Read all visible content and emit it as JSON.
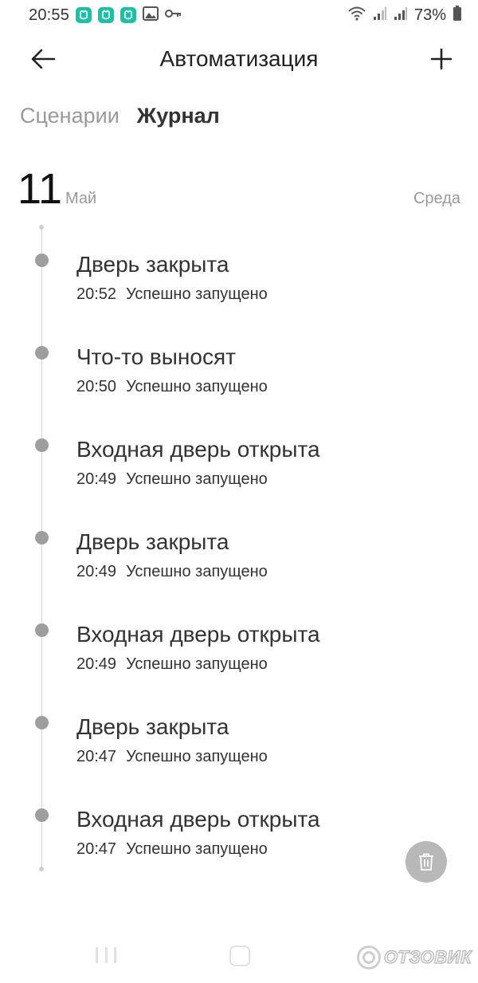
{
  "statusbar": {
    "time": "20:55",
    "battery": "73%",
    "icons": [
      "mi-home-icon",
      "mi-home-icon",
      "mi-home-icon",
      "image-icon",
      "key-icon",
      "wifi-icon",
      "signal-icon",
      "signal-icon",
      "battery-icon"
    ]
  },
  "header": {
    "title": "Автоматизация",
    "back_icon": "arrow-left-icon",
    "add_icon": "plus-icon"
  },
  "tabs": [
    {
      "label": "Сценарии",
      "active": false
    },
    {
      "label": "Журнал",
      "active": true
    }
  ],
  "date": {
    "day": "11",
    "month": "Май",
    "weekday": "Среда"
  },
  "entries": [
    {
      "title": "Дверь закрыта",
      "time": "20:52",
      "status": "Успешно запущено"
    },
    {
      "title": "Что-то выносят",
      "time": "20:50",
      "status": "Успешно запущено"
    },
    {
      "title": "Входная дверь открыта",
      "time": "20:49",
      "status": "Успешно запущено"
    },
    {
      "title": "Дверь закрыта",
      "time": "20:49",
      "status": "Успешно запущено"
    },
    {
      "title": "Входная дверь открыта",
      "time": "20:49",
      "status": "Успешно запущено"
    },
    {
      "title": "Дверь закрыта",
      "time": "20:47",
      "status": "Успешно запущено"
    },
    {
      "title": "Входная дверь открыта",
      "time": "20:47",
      "status": "Успешно запущено"
    }
  ],
  "fab": {
    "icon": "trash-icon"
  },
  "watermark": {
    "text": "ОТЗОВИК"
  },
  "colors": {
    "accent_app_icon": "#1fbfa6",
    "dot": "#9e9e9e",
    "fab": "#b8b8b8",
    "inactive_text": "#9a9a9a"
  }
}
